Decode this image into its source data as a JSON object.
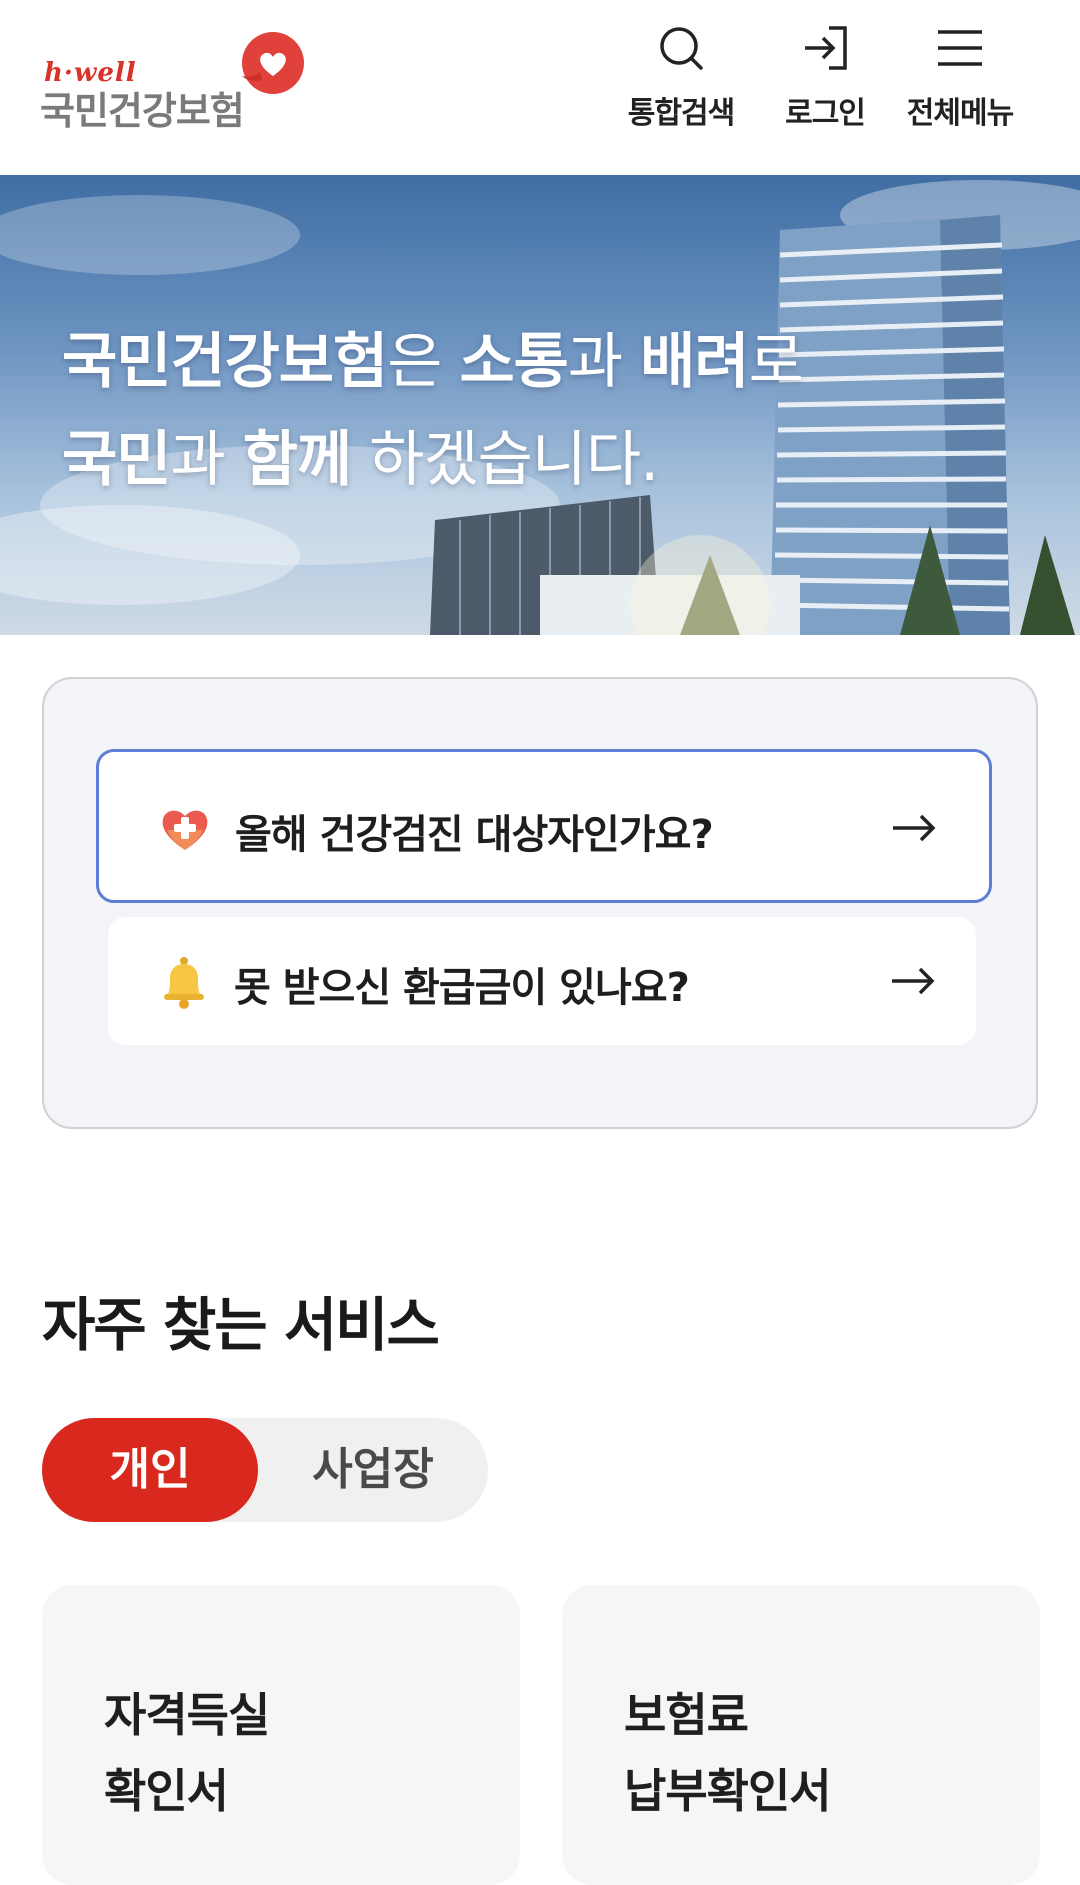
{
  "header": {
    "logo": {
      "tagline": "h·well",
      "name": "국민건강보험"
    },
    "nav": [
      {
        "label": "통합검색",
        "icon": "search-icon"
      },
      {
        "label": "로그인",
        "icon": "login-icon"
      },
      {
        "label": "전체메뉴",
        "icon": "hamburger-menu-icon"
      }
    ]
  },
  "hero": {
    "line1": {
      "a": "국민건강보험",
      "b": "은 ",
      "c": "소통",
      "d": "과 ",
      "e": "배려",
      "f": "로"
    },
    "line2": {
      "a": "국민",
      "b": "과 ",
      "c": "함께",
      "d": " 하겠습니다."
    }
  },
  "quick": {
    "items": [
      {
        "label": "올해 건강검진 대상자인가요?",
        "icon": "heart-plus-icon"
      },
      {
        "label": "못 받으신 환급금이 있나요?",
        "icon": "bell-icon"
      }
    ]
  },
  "services": {
    "title": "자주 찾는 서비스",
    "tabs": [
      {
        "label": "개인",
        "selected": true
      },
      {
        "label": "사업장",
        "selected": false
      }
    ],
    "cards": [
      {
        "line1": "자격득실",
        "line2": "확인서"
      },
      {
        "line1": "보험료",
        "line2": "납부확인서"
      }
    ]
  },
  "colors": {
    "brand_red": "#d9291f",
    "focus_blue": "#5b7fd6",
    "panel_bg": "#f3f4f8"
  }
}
